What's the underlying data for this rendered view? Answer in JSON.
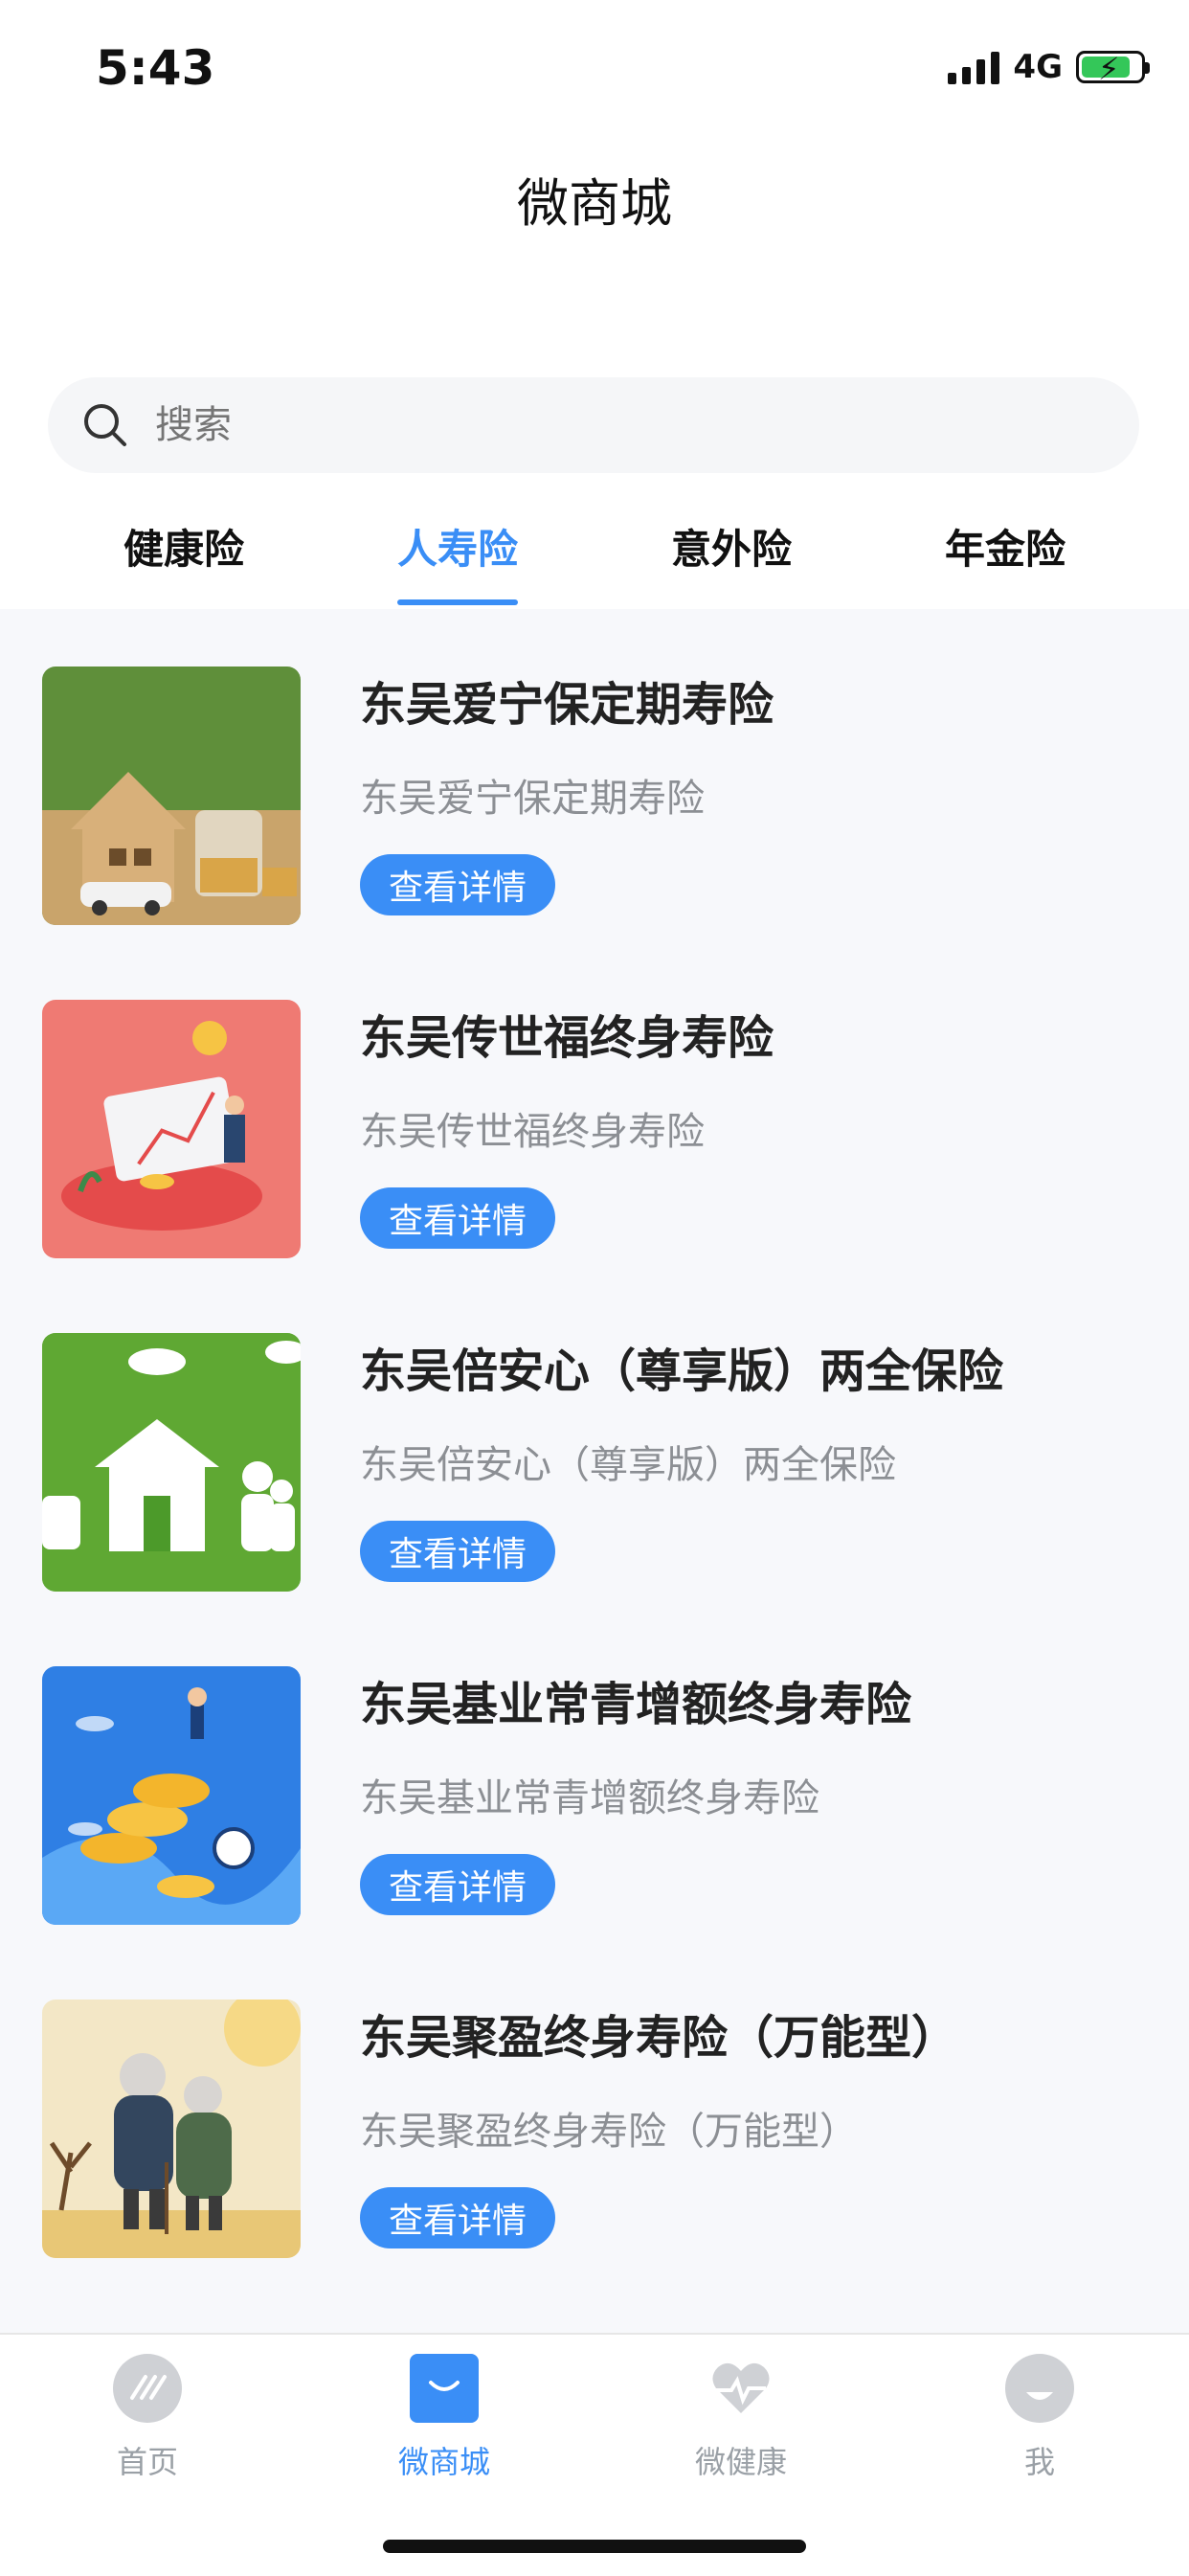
{
  "status": {
    "time": "5:43",
    "network": "4G"
  },
  "header": {
    "title": "微商城"
  },
  "search": {
    "placeholder": "搜索"
  },
  "tabs": [
    {
      "label": "健康险",
      "active": false
    },
    {
      "label": "人寿险",
      "active": true
    },
    {
      "label": "意外险",
      "active": false
    },
    {
      "label": "年金险",
      "active": false
    }
  ],
  "products": [
    {
      "title": "东吴爱宁保定期寿险",
      "subtitle": "东吴爱宁保定期寿险",
      "button": "查看详情",
      "image": "house-coins-image"
    },
    {
      "title": "东吴传世福终身寿险",
      "subtitle": "东吴传世福终身寿险",
      "button": "查看详情",
      "image": "growth-chart-image"
    },
    {
      "title": "东吴倍安心（尊享版）两全保险",
      "subtitle": "东吴倍安心（尊享版）两全保险",
      "button": "查看详情",
      "image": "family-house-grass-image"
    },
    {
      "title": "东吴基业常青增额终身寿险",
      "subtitle": "东吴基业常青增额终身寿险",
      "button": "查看详情",
      "image": "coins-climb-image"
    },
    {
      "title": "东吴聚盈终身寿险（万能型）",
      "subtitle": "东吴聚盈终身寿险（万能型）",
      "button": "查看详情",
      "image": "elderly-couple-image"
    }
  ],
  "tabbar": [
    {
      "label": "首页",
      "icon": "home-logo-icon",
      "active": false
    },
    {
      "label": "微商城",
      "icon": "shop-bag-icon",
      "active": true
    },
    {
      "label": "微健康",
      "icon": "health-heart-icon",
      "active": false
    },
    {
      "label": "我",
      "icon": "profile-icon",
      "active": false
    }
  ],
  "colors": {
    "accent": "#3a8ef6",
    "inactive": "#9aa0a6",
    "background": "#f7f8fb"
  }
}
